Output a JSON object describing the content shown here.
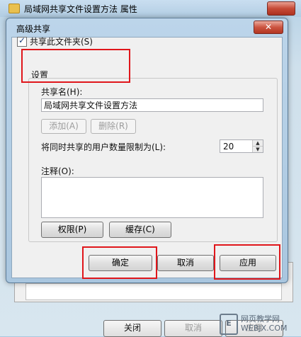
{
  "background_window": {
    "title": "局域网共享文件设置方法 属性",
    "buttons": [
      {
        "label": "关闭",
        "disabled": false
      },
      {
        "label": "取消",
        "disabled": true
      },
      {
        "label": "应用",
        "disabled": true
      }
    ]
  },
  "dialog": {
    "title": "高级共享",
    "close_glyph": "✕",
    "share_checkbox_label": "共享此文件夹(S)",
    "share_checked": true,
    "settings_label": "设置",
    "share_name_label": "共享名(H):",
    "share_name_value": "局域网共享文件设置方法",
    "add_button": "添加(A)",
    "remove_button": "删除(R)",
    "user_limit_label": "将同时共享的用户数量限制为(L):",
    "user_limit_value": "20",
    "comment_label": "注释(O):",
    "comment_value": "",
    "permissions_button": "权限(P)",
    "cache_button": "缓存(C)",
    "ok_button": "确定",
    "cancel_button": "取消",
    "apply_button": "应用"
  },
  "annotation_color": "#e0161b",
  "watermark": {
    "text_line1": "网页教学网",
    "text_line2": "WEBJX.COM"
  }
}
